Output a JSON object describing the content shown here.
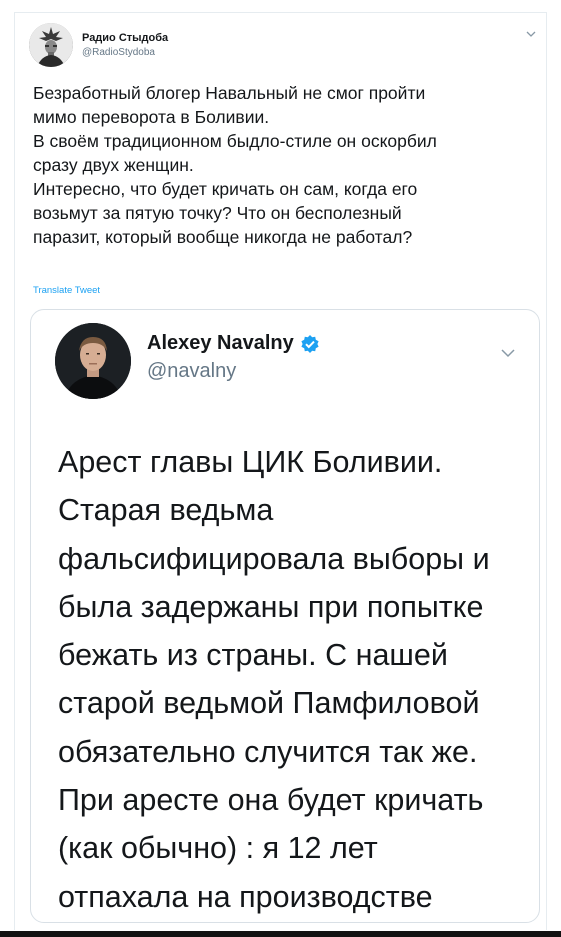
{
  "tweet": {
    "author_name": "Радио Стыдоба",
    "author_handle": "@RadioStydoba",
    "text": "Безработный блогер Навальный не смог пройти\nмимо переворота в Боливии.\nВ своём традиционном быдло-стиле он оскорбил\nсразу двух женщин.\nИнтересно, что будет кричать он сам, когда его\nвозьмут за пятую точку? Что он бесполезный\nпаразит, который вообще никогда не работал?",
    "translate_label": "Translate Tweet",
    "avatar_icon": "statue-avatar-icon",
    "menu_icon": "chevron-down-icon"
  },
  "quoted_tweet": {
    "author_name": "Alexey Navalny",
    "author_handle": "@navalny",
    "verified_icon": "verified-badge-icon",
    "text": "Арест главы ЦИК Боливии.\nСтарая ведьма\nфальсифицировала выборы и\nбыла задержаны при попытке\nбежать из страны. С нашей\nстарой ведьмой Памфиловой\nобязательно случится так же.\nПри аресте она будет кричать\n(как обычно) : я 12 лет\nотпахала на производстве",
    "menu_icon": "chevron-down-icon"
  },
  "colors": {
    "text": "#14171a",
    "secondary": "#657786",
    "link": "#1da1f2",
    "border": "#e6ecf0",
    "verified": "#1da1f2"
  }
}
